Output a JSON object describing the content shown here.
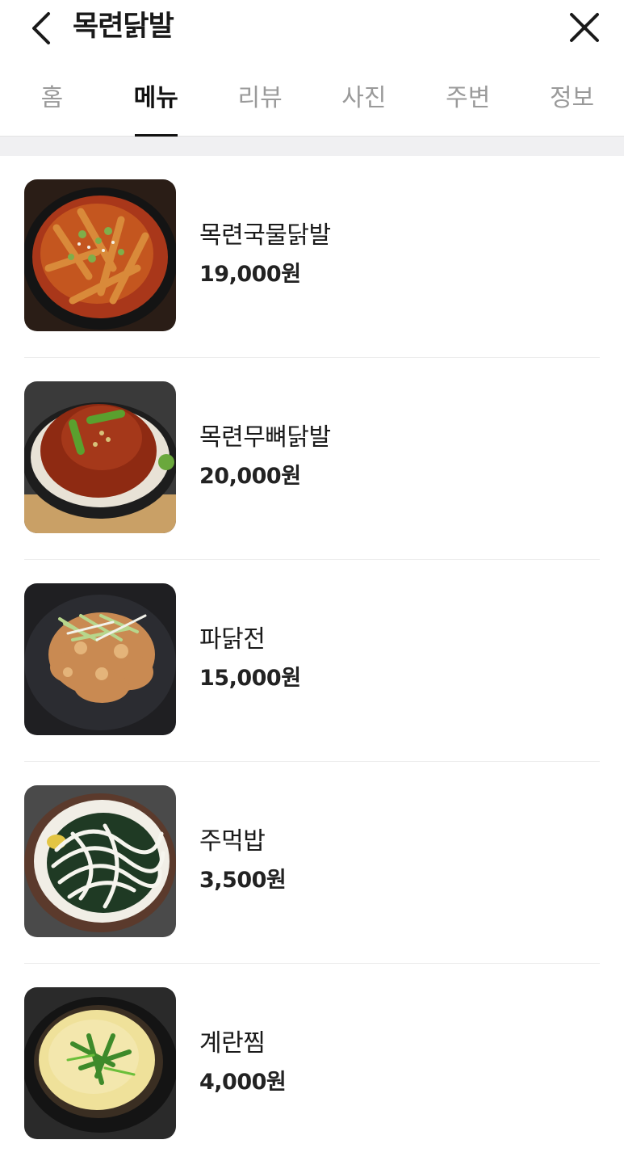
{
  "header": {
    "title": "목련닭발"
  },
  "tabs": [
    {
      "label": "홈",
      "active": false
    },
    {
      "label": "메뉴",
      "active": true
    },
    {
      "label": "리뷰",
      "active": false
    },
    {
      "label": "사진",
      "active": false
    },
    {
      "label": "주변",
      "active": false
    },
    {
      "label": "정보",
      "active": false
    }
  ],
  "menu": [
    {
      "name": "목련국물닭발",
      "price": "19,000원"
    },
    {
      "name": "목련무뼈닭발",
      "price": "20,000원"
    },
    {
      "name": "파닭전",
      "price": "15,000원"
    },
    {
      "name": "주먹밥",
      "price": "3,500원"
    },
    {
      "name": "계란찜",
      "price": "4,000원"
    }
  ],
  "colors": {
    "text_primary": "#1a1a1a",
    "tab_inactive": "#9a9a9a",
    "divider": "#ededed",
    "band": "#f0f0f2"
  },
  "icons": {
    "back": "chevron-left-icon",
    "close": "close-icon"
  }
}
